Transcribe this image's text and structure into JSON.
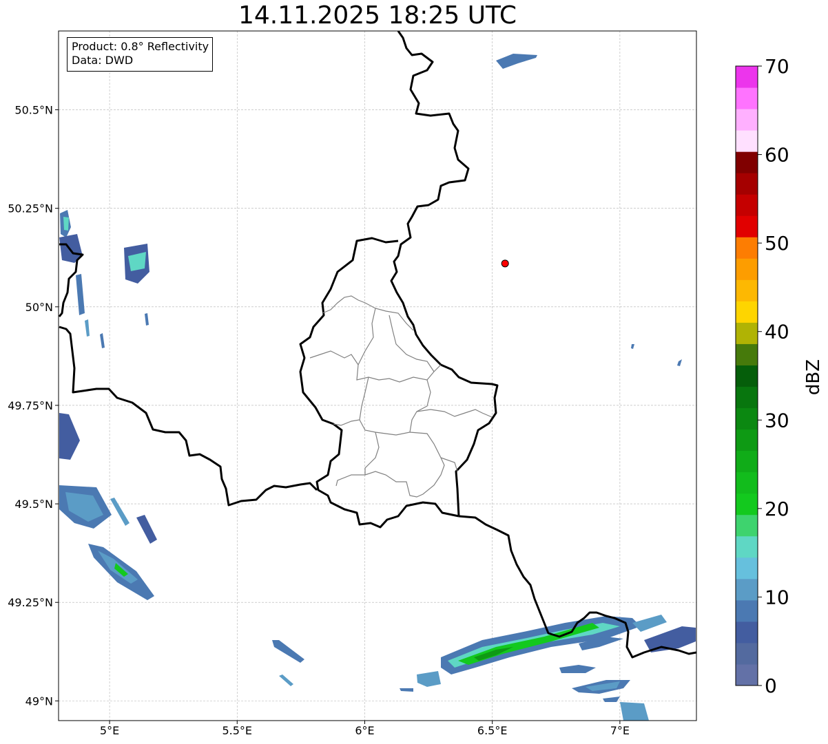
{
  "title": "14.11.2025 18:25 UTC",
  "info_box": {
    "product_line": "Product: 0.8° Reflectivity",
    "data_line": "Data: DWD"
  },
  "map": {
    "lon_range": [
      4.8,
      7.3
    ],
    "lat_range": [
      48.95,
      50.7
    ],
    "lon_ticks": [
      {
        "value": 5.0,
        "label": "5°E"
      },
      {
        "value": 5.5,
        "label": "5.5°E"
      },
      {
        "value": 6.0,
        "label": "6°E"
      },
      {
        "value": 6.5,
        "label": "6.5°E"
      },
      {
        "value": 7.0,
        "label": "7°E"
      }
    ],
    "lat_ticks": [
      {
        "value": 49.0,
        "label": "49°N"
      },
      {
        "value": 49.25,
        "label": "49.25°N"
      },
      {
        "value": 49.5,
        "label": "49.5°N"
      },
      {
        "value": 49.75,
        "label": "49.75°N"
      },
      {
        "value": 50.0,
        "label": "50°N"
      },
      {
        "value": 50.25,
        "label": "50.25°N"
      },
      {
        "value": 50.5,
        "label": "50.5°N"
      }
    ],
    "gridlines": true,
    "radar_site": {
      "lon": 6.55,
      "lat": 50.11,
      "color": "#ff0000"
    }
  },
  "colorbar": {
    "label": "dBZ",
    "min": 0,
    "max": 70,
    "tick_values": [
      0,
      10,
      20,
      30,
      40,
      50,
      60,
      70
    ],
    "colors": [
      "#6371a7",
      "#536a9f",
      "#435da0",
      "#4b79b2",
      "#5b9cc6",
      "#66c0dd",
      "#5fd7c4",
      "#3ed36e",
      "#13c91e",
      "#12bc1c",
      "#10ac18",
      "#0e9a14",
      "#0b8811",
      "#08760e",
      "#055e0a",
      "#467a0b",
      "#b0b304",
      "#fed500",
      "#fdb802",
      "#fd9d00",
      "#fd7d02",
      "#e10000",
      "#c50000",
      "#a50000",
      "#800000",
      "#ffe0ff",
      "#ffb0ff",
      "#ff73ff",
      "#ec35ec"
    ]
  }
}
